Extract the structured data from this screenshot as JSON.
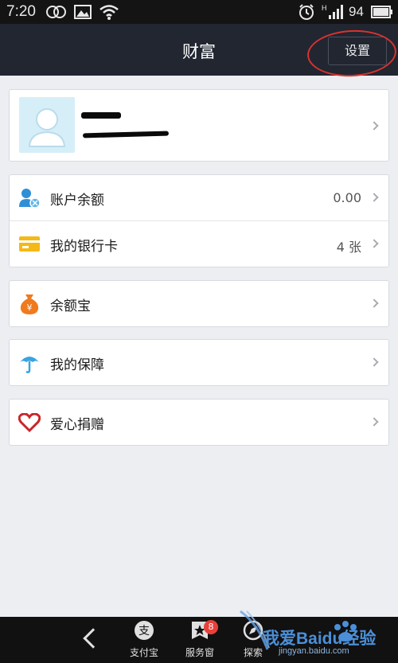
{
  "status_bar": {
    "time": "7:20",
    "battery": "94",
    "network": "H"
  },
  "header": {
    "title": "财富",
    "settings_label": "设置"
  },
  "profile": {
    "avatar": "user-avatar-placeholder",
    "name_redacted": true
  },
  "menu_groups": [
    {
      "rows": [
        {
          "icon": "account-balance-icon",
          "label": "账户余额",
          "value": "0.00"
        },
        {
          "icon": "bank-card-icon",
          "label": "我的银行卡",
          "value": "4 张"
        }
      ]
    },
    {
      "rows": [
        {
          "icon": "money-bag-icon",
          "label": "余额宝",
          "value": ""
        }
      ]
    },
    {
      "rows": [
        {
          "icon": "umbrella-icon",
          "label": "我的保障",
          "value": ""
        }
      ]
    },
    {
      "rows": [
        {
          "icon": "heart-icon",
          "label": "爱心捐赠",
          "value": ""
        }
      ]
    }
  ],
  "bottom_nav": {
    "tabs": [
      {
        "label": "支付宝",
        "glyph": "支"
      },
      {
        "label": "服务窗",
        "badge": "8"
      },
      {
        "label": "探索"
      }
    ]
  },
  "watermark": {
    "text": "我爱Baidu经验",
    "url": "jingyan.baidu.com"
  },
  "colors": {
    "header_bg": "#212631",
    "page_bg": "#eceef2",
    "highlight": "#d9322e",
    "bank_card": "#f5b915",
    "money_bag": "#f07a1e",
    "umbrella": "#3aa3e0",
    "heart": "#c8262c"
  }
}
